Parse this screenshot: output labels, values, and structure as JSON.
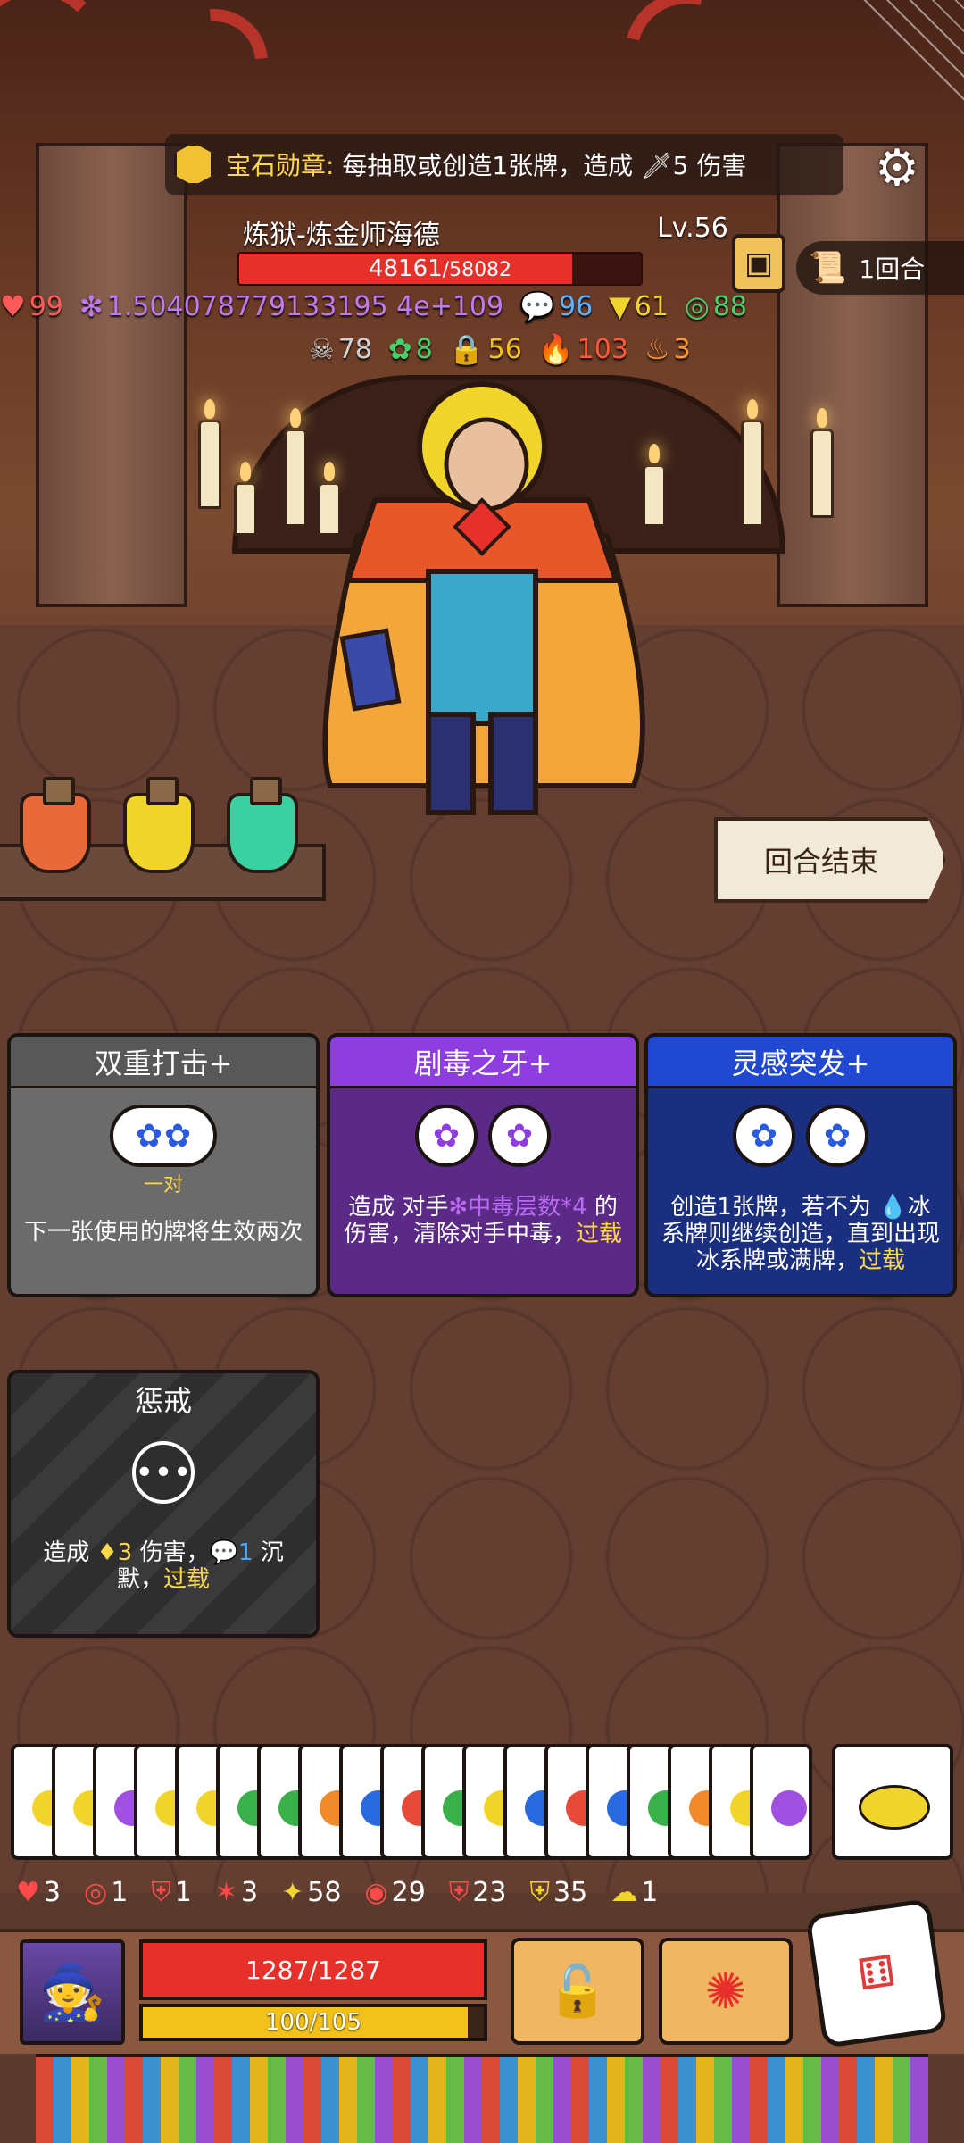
{
  "badge": {
    "name": "宝石勋章",
    "colon": ":",
    "desc": "每抽取或创造1张牌，造成",
    "damage": "5",
    "damage_suffix": "伤害"
  },
  "enemy": {
    "name": "炼狱-炼金师海德",
    "level": "Lv.56",
    "hp": "48161",
    "hp_max": "/58082",
    "hp_fraction": 0.829
  },
  "turn": {
    "label": "1回合"
  },
  "enemy_stats_row1": [
    {
      "icon": "heart-icon",
      "glyph": "♥",
      "value": "99",
      "color": "#ff5a5a"
    },
    {
      "icon": "poison-icon",
      "glyph": "✻",
      "value": "1.504078779133195 4e+109",
      "color": "#c07af0"
    },
    {
      "icon": "silence-icon",
      "glyph": "💬",
      "value": "96",
      "color": "#5ab4ff"
    },
    {
      "icon": "triangle-icon",
      "glyph": "▼",
      "value": "61",
      "color": "#f2d52a"
    },
    {
      "icon": "shield-swirl-icon",
      "glyph": "◎",
      "value": "88",
      "color": "#4ad06a"
    }
  ],
  "enemy_stats_row2": [
    {
      "icon": "skull-icon",
      "glyph": "☠",
      "value": "78",
      "color": "#d0d0d0"
    },
    {
      "icon": "gear-green-icon",
      "glyph": "✿",
      "value": "8",
      "color": "#4ad06a"
    },
    {
      "icon": "lock-icon",
      "glyph": "🔒",
      "value": "56",
      "color": "#f2c21a"
    },
    {
      "icon": "fire-icon",
      "glyph": "🔥",
      "value": "103",
      "color": "#ff5a3a"
    },
    {
      "icon": "flame-orange-icon",
      "glyph": "♨",
      "value": "3",
      "color": "#ff9a3a"
    }
  ],
  "end_turn_label": "回合结束",
  "cards": {
    "double_strike": {
      "title": "双重打击+",
      "slot_label": "一对",
      "desc": "下一张使用的牌将生效两次"
    },
    "venom_fang": {
      "title": "剧毒之牙+",
      "desc_a": "造成 对手",
      "desc_b": "中毒层数*4",
      "desc_c": " 的伤害，清除对手中毒，",
      "overload": "过载"
    },
    "inspiration": {
      "title": "灵感突发+",
      "desc_a": "创造1张牌，若不为 ",
      "desc_b": "冰系",
      "desc_c": "牌则继续创造，直到出现冰系牌或满牌，",
      "overload": "过载"
    },
    "punish": {
      "title": "惩戒",
      "desc_a": "造成 ",
      "desc_dmg": "3",
      "desc_b": " 伤害，",
      "desc_silence": "1",
      "desc_c": " 沉默，",
      "overload": "过载"
    }
  },
  "hand_colors": [
    "#f2d52a",
    "#f2d52a",
    "#a050e0",
    "#f2d52a",
    "#f2d52a",
    "#3ab04a",
    "#3ab04a",
    "#f08a2a",
    "#2a6ae0",
    "#e84a3a",
    "#3ab04a",
    "#f2d52a",
    "#2a6ae0",
    "#e84a3a",
    "#2a6ae0",
    "#3ab04a",
    "#f08a2a",
    "#f2d52a",
    "#a050e0"
  ],
  "buffs": [
    {
      "icon": "heart-shield-icon",
      "glyph": "♥",
      "value": "3",
      "color": "#ff4a4a"
    },
    {
      "icon": "target-icon",
      "glyph": "◎",
      "value": "1",
      "color": "#ff4a4a"
    },
    {
      "icon": "armor-icon",
      "glyph": "⛨",
      "value": "1",
      "color": "#ff4a4a"
    },
    {
      "icon": "claw-icon",
      "glyph": "✶",
      "value": "3",
      "color": "#ff4a4a"
    },
    {
      "icon": "lightning-icon",
      "glyph": "✦",
      "value": "58",
      "color": "#f2d52a"
    },
    {
      "icon": "swirl-icon",
      "glyph": "◉",
      "value": "29",
      "color": "#ff4a4a"
    },
    {
      "icon": "shield-icon",
      "glyph": "⛨",
      "value": "23",
      "color": "#ff4a4a"
    },
    {
      "icon": "gold-shield-icon",
      "glyph": "⛨",
      "value": "35",
      "color": "#f2d52a"
    },
    {
      "icon": "wind-icon",
      "glyph": "☁",
      "value": "1",
      "color": "#f2d52a"
    }
  ],
  "player": {
    "hp": "1287/1287",
    "energy": "100/105",
    "energy_fraction": 0.952
  }
}
